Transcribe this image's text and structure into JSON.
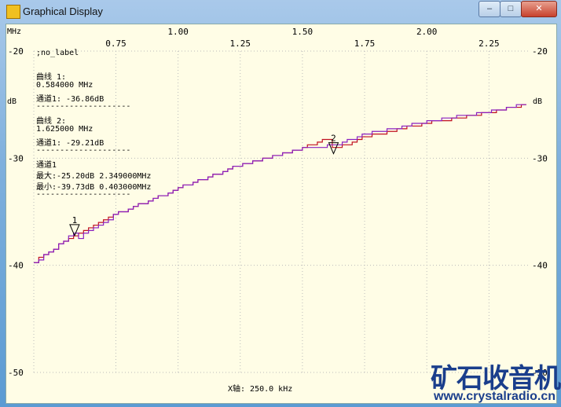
{
  "window": {
    "title": "Graphical Display",
    "minimize": "–",
    "maximize": "□",
    "close": "✕"
  },
  "watermark": {
    "cn": "矿石收音机",
    "url": "www.crystalradio.cn"
  },
  "info": {
    "no_label": ";no_label",
    "m1_title": "曲线 1:",
    "m1_freq": "0.584000 MHz",
    "m1_val": "通道1: -36.86dB",
    "m2_title": "曲线 2:",
    "m2_freq": "1.625000 MHz",
    "m2_val": "通道1: -29.21dB",
    "sep": "--------------------",
    "ch": "通道1",
    "max": "最大:-25.20dB 2.349000MHz",
    "min": "最小:-39.73dB 0.403000MHz"
  },
  "chart_data": {
    "type": "line",
    "xlabel": "MHz",
    "ylabel": "dB",
    "xaxis_note": "X轴: 250.0 kHz",
    "xlim": [
      0.42,
      2.41
    ],
    "ylim": [
      -50,
      -20
    ],
    "xticks_top": [
      "1.00",
      "1.50",
      "2.00"
    ],
    "xticks_bottom": [
      "0.75",
      "1.25",
      "1.75",
      "2.25"
    ],
    "xtick_values": [
      0.75,
      1.0,
      1.25,
      1.5,
      1.75,
      2.0,
      2.25
    ],
    "yticks": [
      "-20",
      "-30",
      "-40",
      "-50"
    ],
    "series": [
      {
        "name": "曲线 1",
        "color": "#c01020",
        "x": [
          0.42,
          0.5,
          0.6,
          0.75,
          0.9,
          1.0,
          1.25,
          1.5,
          1.6,
          1.625,
          1.75,
          2.0,
          2.25,
          2.41
        ],
        "y": [
          -39.7,
          -38.4,
          -37.0,
          -35.2,
          -33.8,
          -32.8,
          -30.6,
          -29.0,
          -28.2,
          -29.2,
          -28.0,
          -26.7,
          -25.7,
          -24.9
        ]
      },
      {
        "name": "曲线 2",
        "color": "#8a20c0",
        "x": [
          0.42,
          0.5,
          0.584,
          0.6,
          0.75,
          0.9,
          1.0,
          1.25,
          1.5,
          1.625,
          1.75,
          2.0,
          2.25,
          2.41
        ],
        "y": [
          -39.7,
          -38.5,
          -36.9,
          -37.4,
          -35.2,
          -33.8,
          -32.8,
          -30.6,
          -29.1,
          -28.8,
          -27.7,
          -26.6,
          -25.6,
          -24.9
        ]
      }
    ],
    "markers": [
      {
        "label": "1",
        "x": 0.584,
        "y": -36.86
      },
      {
        "label": "2",
        "x": 1.625,
        "y": -29.21
      }
    ]
  }
}
